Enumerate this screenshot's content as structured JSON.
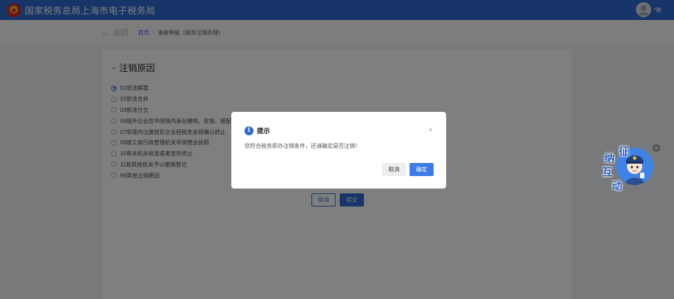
{
  "header": {
    "site_title": "国家税务总局上海市电子税务局",
    "user_name": "*敏"
  },
  "breadcrumb": {
    "back_label": "返回",
    "home": "首页",
    "current": "清税申报（税务注销办理）"
  },
  "section": {
    "title": "注销原因",
    "reasons": [
      {
        "label": "01依法解散",
        "checked": true
      },
      {
        "label": "02依法合并",
        "checked": false
      },
      {
        "label": "03依法分立",
        "checked": false
      },
      {
        "label": "06境外企业在中国境内承包建筑、安装、装配",
        "checked": false
      },
      {
        "label": "07非境内注册居民企业经税务总局确认终止",
        "checked": false
      },
      {
        "label": "09被工商行政管理机关吊销营业执照",
        "checked": false
      },
      {
        "label": "10有关机关批准或者宣告终止",
        "checked": false
      },
      {
        "label": "11被其他机关予以撤销登记",
        "checked": false
      },
      {
        "label": "99其他注销原因",
        "checked": false
      }
    ],
    "cancel_label": "取消",
    "submit_label": "提交"
  },
  "dialog": {
    "title": "提示",
    "message": "您符合税务即办注销条件，还请确定是否注销！",
    "close_symbol": "×",
    "cancel_label": "取消",
    "confirm_label": "确定"
  },
  "widget": {
    "chars": [
      "征",
      "纳",
      "互",
      "动"
    ],
    "close_symbol": "−"
  },
  "colors": {
    "brand": "#2e6bd0",
    "confirm_button": "#3d7be8",
    "overlay": "rgba(0,0,0,0.5)"
  }
}
